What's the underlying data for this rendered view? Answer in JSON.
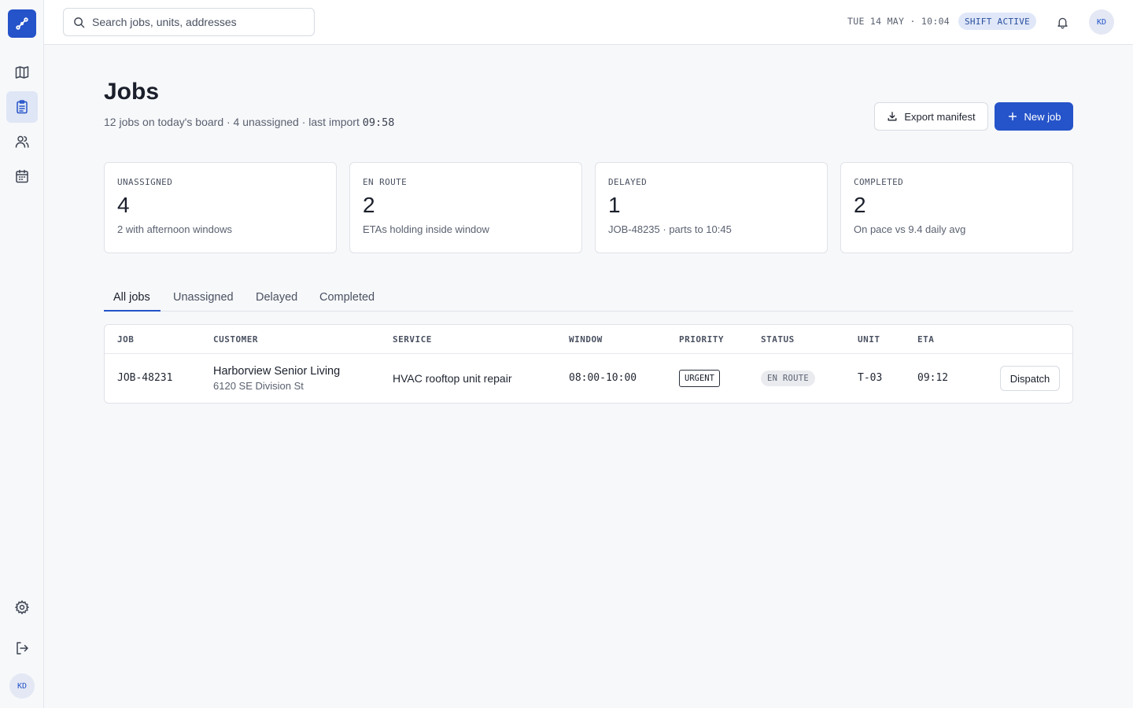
{
  "topbar": {
    "search_placeholder": "Search jobs, units, addresses",
    "datetime": "TUE 14 MAY · 10:04",
    "shift_status": "SHIFT ACTIVE",
    "user_initials": "KD"
  },
  "sidebar": {
    "items": [
      {
        "icon": "map-icon",
        "active": false
      },
      {
        "icon": "clipboard-icon",
        "active": true
      },
      {
        "icon": "users-icon",
        "active": false
      },
      {
        "icon": "calendar-icon",
        "active": false
      }
    ],
    "bottom": [
      {
        "icon": "gear-icon"
      },
      {
        "icon": "logout-icon"
      }
    ],
    "user_initials": "KD"
  },
  "page": {
    "title": "Jobs",
    "subtitle": "12 jobs on today's board · 4 unassigned · last import",
    "last_import": "09:58"
  },
  "actions": {
    "export_label": "Export manifest",
    "new_label": "New job"
  },
  "stats": [
    {
      "label": "UNASSIGNED",
      "value": "4",
      "note": "2 with afternoon windows"
    },
    {
      "label": "EN ROUTE",
      "value": "2",
      "note": "ETAs holding inside window"
    },
    {
      "label": "DELAYED",
      "value": "1",
      "note": "JOB-48235 · parts to 10:45"
    },
    {
      "label": "COMPLETED",
      "value": "2",
      "note": "On pace vs 9.4 daily avg"
    }
  ],
  "tabs": [
    {
      "label": "All jobs",
      "active": true
    },
    {
      "label": "Unassigned",
      "active": false
    },
    {
      "label": "Delayed",
      "active": false
    },
    {
      "label": "Completed",
      "active": false
    }
  ],
  "table": {
    "columns": [
      "JOB",
      "CUSTOMER",
      "SERVICE",
      "WINDOW",
      "PRIORITY",
      "STATUS",
      "UNIT",
      "ETA"
    ],
    "rows": [
      {
        "job": "JOB-48231",
        "customer": "Harborview Senior Living",
        "address": "6120 SE Division St",
        "service": "HVAC rooftop unit repair",
        "window": "08:00-10:00",
        "priority": "URGENT",
        "status": "EN ROUTE",
        "unit": "T-03",
        "eta": "09:12",
        "action": "Dispatch"
      }
    ]
  },
  "colors": {
    "accent": "#2553c9",
    "background": "#f7f8fa",
    "badge_blue_bg": "#dfe7f8"
  }
}
